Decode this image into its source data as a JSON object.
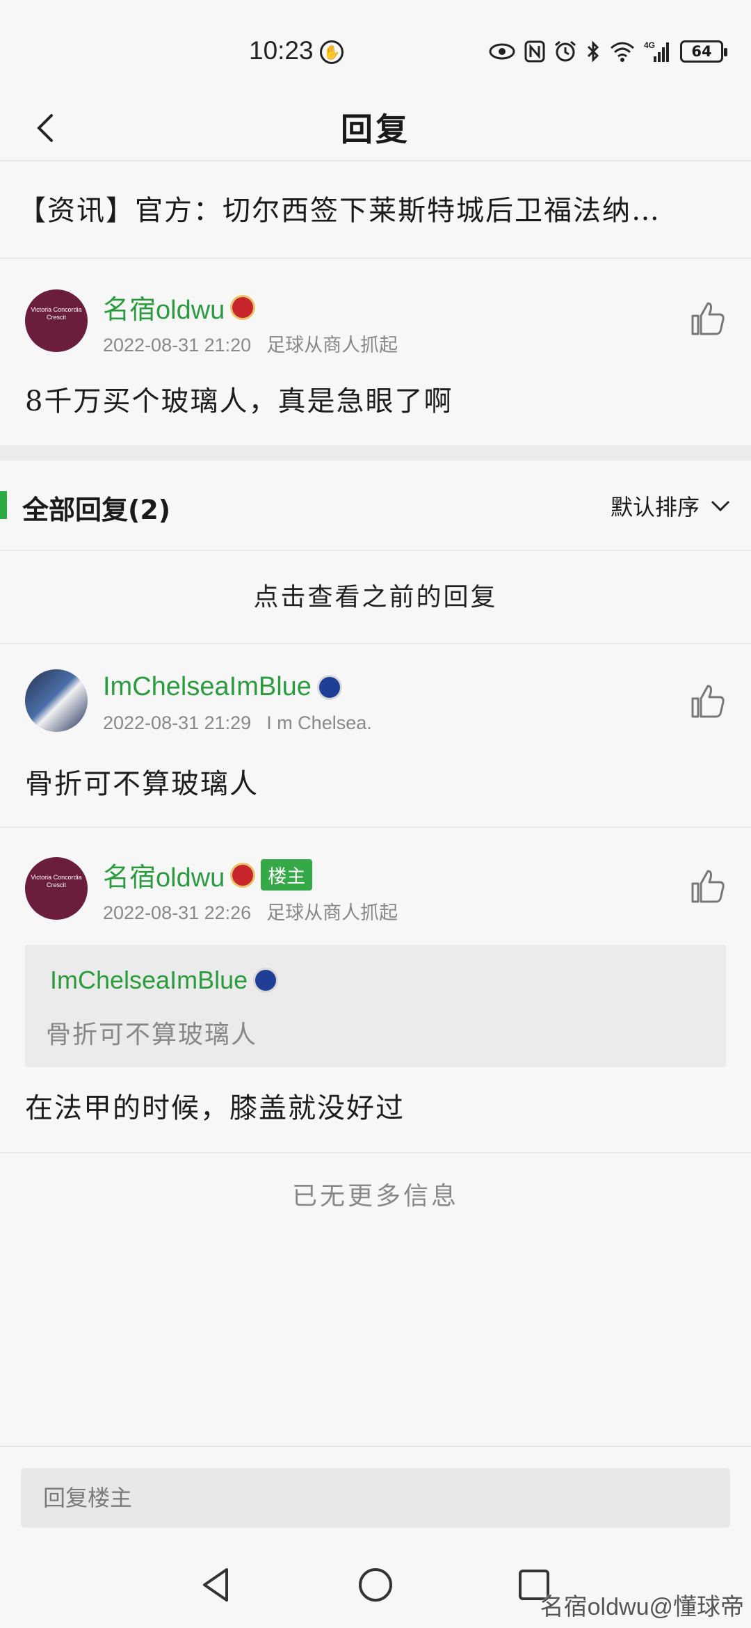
{
  "status_bar": {
    "time": "10:23",
    "network": "4G",
    "battery": "64"
  },
  "header": {
    "title": "回复"
  },
  "post": {
    "title": "【资讯】官方：切尔西签下莱斯特城后卫福法纳…"
  },
  "original_comment": {
    "username": "名宿oldwu",
    "timestamp": "2022-08-31 21:20",
    "signature": "足球从商人抓起",
    "content": "8千万买个玻璃人，真是急眼了啊",
    "avatar_text": "Victoria Concordia Crescit"
  },
  "replies_section": {
    "label": "全部回复(2)",
    "sort_label": "默认排序",
    "load_previous": "点击查看之前的回复"
  },
  "replies": [
    {
      "username": "ImChelseaImBlue",
      "timestamp": "2022-08-31 21:29",
      "signature": "I m Chelsea.",
      "content": "骨折可不算玻璃人"
    },
    {
      "username": "名宿oldwu",
      "op_tag": "楼主",
      "timestamp": "2022-08-31 22:26",
      "signature": "足球从商人抓起",
      "quote_user": "ImChelseaImBlue",
      "quote_text": "骨折可不算玻璃人",
      "content": "在法甲的时候，膝盖就没好过",
      "avatar_text": "Victoria Concordia Crescit"
    }
  ],
  "footer": {
    "no_more": "已无更多信息",
    "reply_placeholder": "回复楼主",
    "watermark": "名宿oldwu@懂球帝"
  },
  "colors": {
    "accent_green": "#2b9c3e",
    "op_tag_bg": "#35a847",
    "arsenal_avatar": "#6b1d3e"
  }
}
